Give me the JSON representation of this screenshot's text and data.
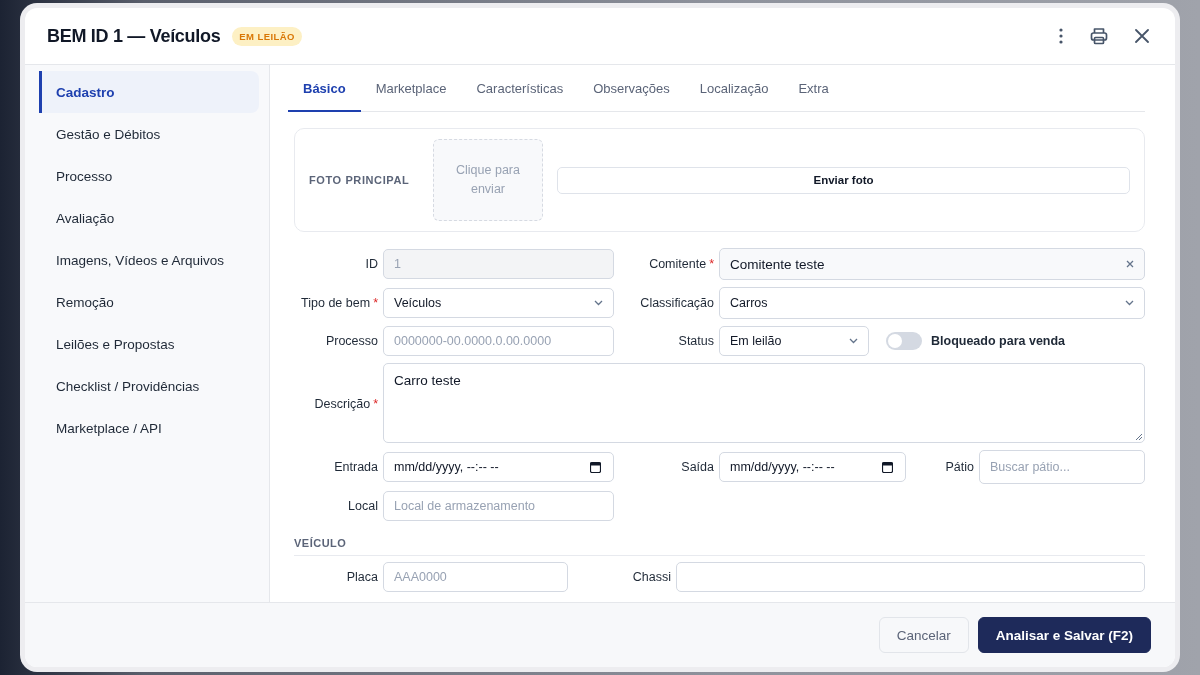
{
  "dialog": {
    "title": "BEM ID 1 — Veículos",
    "badge": "EM LEILÃO"
  },
  "sidebar": {
    "items": [
      {
        "label": "Cadastro",
        "selected": true
      },
      {
        "label": "Gestão e Débitos",
        "selected": false
      },
      {
        "label": "Processo",
        "selected": false
      },
      {
        "label": "Avaliação",
        "selected": false
      },
      {
        "label": "Imagens, Vídeos e Arquivos",
        "selected": false
      },
      {
        "label": "Remoção",
        "selected": false
      },
      {
        "label": "Leilões e Propostas",
        "selected": false
      },
      {
        "label": "Checklist / Providências",
        "selected": false
      },
      {
        "label": "Marketplace / API",
        "selected": false
      }
    ]
  },
  "tabs": [
    {
      "label": "Básico",
      "selected": true
    },
    {
      "label": "Marketplace",
      "selected": false
    },
    {
      "label": "Características",
      "selected": false
    },
    {
      "label": "Observações",
      "selected": false
    },
    {
      "label": "Localização",
      "selected": false
    },
    {
      "label": "Extra",
      "selected": false
    }
  ],
  "photo": {
    "label": "FOTO PRINCIPAL",
    "dropzone": "Clique para enviar",
    "button": "Enviar foto"
  },
  "rows": [
    {
      "kind": "pair",
      "fields": [
        {
          "label": "ID",
          "kind": "text",
          "value": "1",
          "disabled": true
        },
        {
          "label": "Comitente",
          "required_mark": "*",
          "kind": "combo",
          "value": "Comitente teste"
        }
      ]
    },
    {
      "kind": "pair",
      "fields": [
        {
          "label": "Tipo de bem",
          "required_mark": "*",
          "kind": "select",
          "value": "Veículos"
        },
        {
          "label": "Classificação",
          "kind": "select",
          "value": "Carros"
        }
      ]
    },
    {
      "kind": "status",
      "fields": [
        {
          "label": "Processo",
          "kind": "text",
          "placeholder": "0000000-00.0000.0.00.0000"
        },
        {
          "label": "Status",
          "kind": "select",
          "value": "Em leilão"
        },
        {
          "label": "Bloqueado para venda",
          "kind": "toggle",
          "on": false
        }
      ]
    },
    {
      "kind": "full",
      "fields": [
        {
          "label": "Descrição",
          "required_mark": "*",
          "kind": "textarea",
          "value": "Carro teste"
        }
      ]
    },
    {
      "kind": "triple",
      "fields": [
        {
          "label": "Entrada",
          "kind": "date",
          "placeholder": "mm/dd/yyyy, --:-- --"
        },
        {
          "label": "Saída",
          "kind": "date",
          "placeholder": "mm/dd/yyyy, --:-- --"
        },
        {
          "label": "Pátio",
          "kind": "text",
          "placeholder": "Buscar pátio..."
        }
      ]
    },
    {
      "kind": "single",
      "fields": [
        {
          "label": "Local",
          "kind": "text",
          "placeholder": "Local de armazenamento"
        }
      ]
    }
  ],
  "vehicle": {
    "title": "VEÍCULO",
    "rows": [
      {
        "kind": "vehicle",
        "fields": [
          {
            "label": "Placa",
            "kind": "text",
            "placeholder": "AAA0000"
          },
          {
            "label": "Chassi",
            "kind": "text"
          }
        ]
      }
    ]
  },
  "footer": {
    "buttons": [
      {
        "label": "Cancelar",
        "kind": "secondary"
      },
      {
        "label": "Analisar e Salvar (F2)",
        "kind": "primary"
      }
    ]
  }
}
